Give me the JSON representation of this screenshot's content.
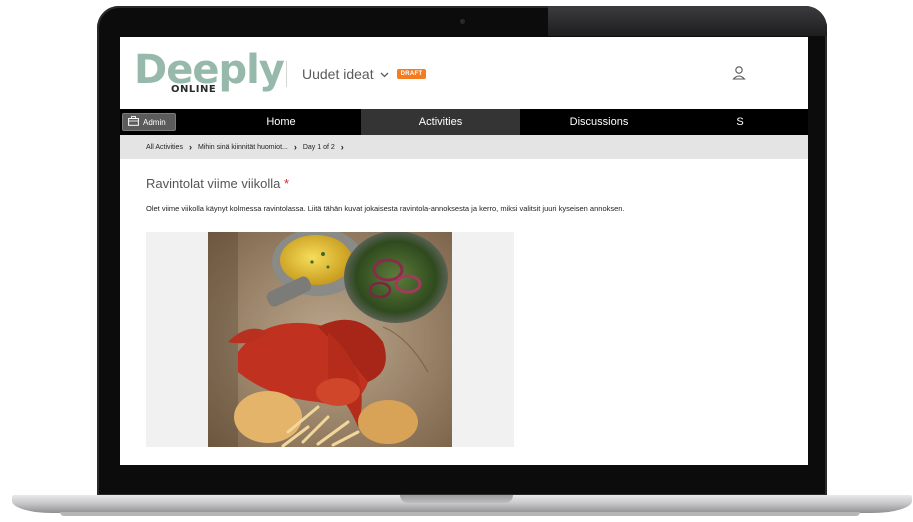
{
  "app": {
    "logo_text": "Deeply",
    "logo_sub": "ONLINE",
    "project_name": "Uudet ideat",
    "draft_badge": "DRAFT"
  },
  "nav": {
    "admin_label": "Admin",
    "tabs": [
      {
        "label": "Home",
        "active": false
      },
      {
        "label": "Activities",
        "active": true
      },
      {
        "label": "Discussions",
        "active": false
      },
      {
        "label": "S",
        "active": false
      }
    ]
  },
  "breadcrumb": {
    "items": [
      "All Activities",
      "Mihin sinä kiinnität huomiot...",
      "Day 1 of 2"
    ]
  },
  "activity": {
    "title": "Ravintolat viime viikolla",
    "required_mark": "*",
    "description": "Olet viime viikolla käynyt kolmessa ravintolassa. Liitä tähän kuvat jokaisesta ravintola-annoksesta ja kerro, miksi valitsit juuri kyseisen annoksen."
  },
  "colors": {
    "nav_bg": "#000000",
    "nav_active": "#343434",
    "draft": "#f47b20",
    "logo": "#97b9ac",
    "required": "#e02424"
  },
  "icons": [
    "briefcase-icon",
    "chevron-down-icon",
    "user-icon",
    "chevron-right-icon"
  ]
}
